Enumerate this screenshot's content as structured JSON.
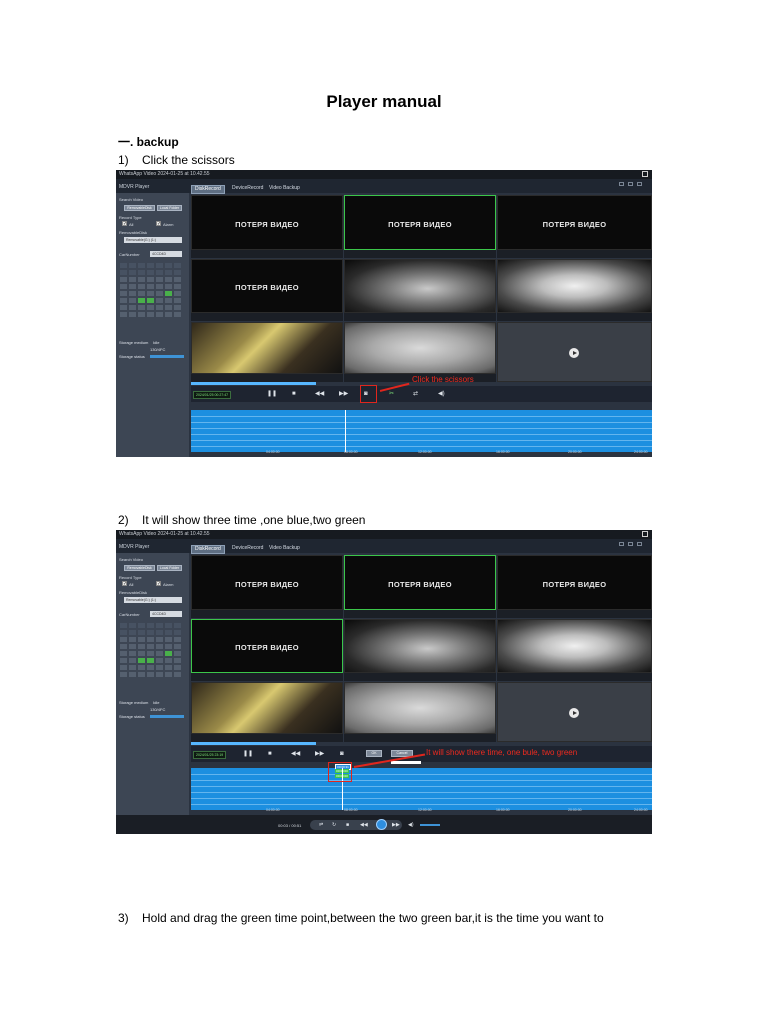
{
  "document": {
    "title": "Player manual",
    "section": "一.   backup",
    "steps": [
      {
        "num": "1)",
        "text": "Click the scissors"
      },
      {
        "num": "2)",
        "text": "It will show three time ,one blue,two green"
      },
      {
        "num": "3)",
        "text": "Hold and drag the green time point,between the two green bar,it is the time you want to"
      }
    ]
  },
  "app": {
    "window_title": "WhatsApp Video 2024-01-25 at 10.42.55",
    "name": "MDVR Player",
    "tabs": [
      "DiskRecord",
      "DeviceRecord",
      "Video Backup"
    ],
    "sidebar": {
      "search_video": "Search Video",
      "btn_removable": "RemovableDisk",
      "btn_local": "Local Folder",
      "record_type": "Record Type",
      "chk_all": "All",
      "chk_alarm": "Alarm",
      "removable_disk": "RemovableDisk",
      "disk_value": "Removable(G:) (1:)",
      "car_number": "CarNumber",
      "car_value": "4CCD4D",
      "storage_medium": "Storage medium",
      "storage_medium_value": "Idle",
      "storage_value": "130/4FC",
      "storage_status": "Storage status"
    },
    "video_label": "ПОТЕРЯ ВИДЕО",
    "controls": {
      "time1": "2024/01/25 00:27:47",
      "time2": "2024/01/25 23:19"
    },
    "shot2_time_markers": [
      "00:00:31",
      "00:00:00",
      "00:00:00"
    ],
    "shot2_buttons": [
      "OK",
      "Cancel"
    ],
    "bottom_time": "00:03 / 00:51",
    "timeline_ticks": [
      "04:00:00",
      "08:00:00",
      "12:00:00",
      "16:00:00",
      "20:00:00",
      "24:00:00"
    ]
  },
  "annotations": {
    "shot1": "Click the scissors",
    "shot2": "It will show there time, one bule, two green"
  },
  "colors": {
    "annotation_red": "#e0261d",
    "timeline_blue": "#1c8fe0",
    "marker_green": "#3cc64a"
  }
}
